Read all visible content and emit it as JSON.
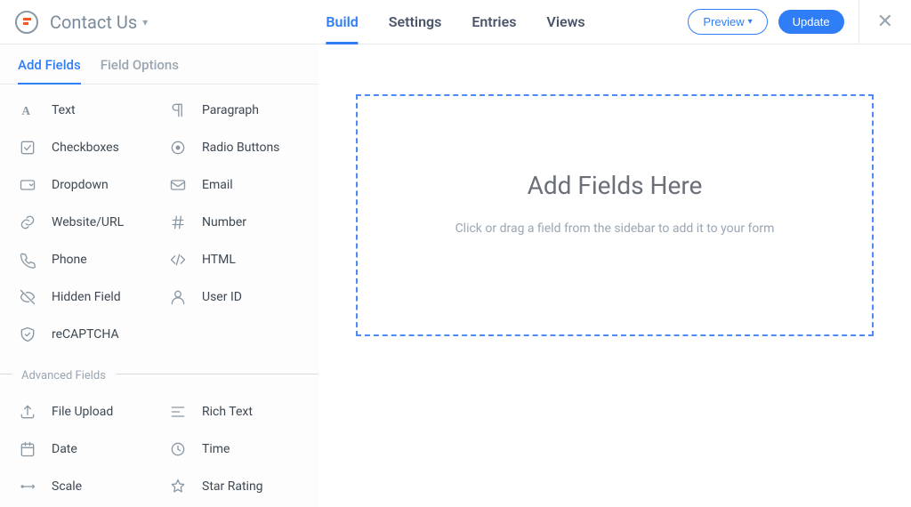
{
  "header": {
    "form_title": "Contact Us",
    "tabs": [
      "Build",
      "Settings",
      "Entries",
      "Views"
    ],
    "active_tab": "Build",
    "preview_label": "Preview",
    "update_label": "Update"
  },
  "sidebar": {
    "tabs": [
      "Add Fields",
      "Field Options"
    ],
    "active_tab": "Add Fields",
    "basic_fields": [
      {
        "icon": "text",
        "label": "Text"
      },
      {
        "icon": "paragraph",
        "label": "Paragraph"
      },
      {
        "icon": "checkbox",
        "label": "Checkboxes"
      },
      {
        "icon": "radio",
        "label": "Radio Buttons"
      },
      {
        "icon": "dropdown",
        "label": "Dropdown"
      },
      {
        "icon": "email",
        "label": "Email"
      },
      {
        "icon": "link",
        "label": "Website/URL"
      },
      {
        "icon": "hash",
        "label": "Number"
      },
      {
        "icon": "phone",
        "label": "Phone"
      },
      {
        "icon": "code",
        "label": "HTML"
      },
      {
        "icon": "hidden",
        "label": "Hidden Field"
      },
      {
        "icon": "user",
        "label": "User ID"
      },
      {
        "icon": "shield",
        "label": "reCAPTCHA"
      }
    ],
    "advanced_header": "Advanced Fields",
    "advanced_fields": [
      {
        "icon": "upload",
        "label": "File Upload"
      },
      {
        "icon": "richtext",
        "label": "Rich Text"
      },
      {
        "icon": "date",
        "label": "Date"
      },
      {
        "icon": "time",
        "label": "Time"
      },
      {
        "icon": "scale",
        "label": "Scale"
      },
      {
        "icon": "star",
        "label": "Star Rating"
      }
    ]
  },
  "canvas": {
    "title": "Add Fields Here",
    "subtitle": "Click or drag a field from the sidebar to add it to your form"
  }
}
